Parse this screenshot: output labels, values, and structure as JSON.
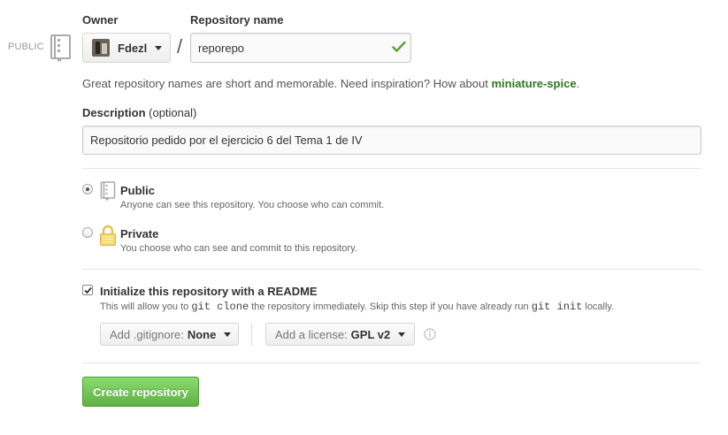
{
  "visibility_tag": "PUBLIC",
  "owner": {
    "label": "Owner",
    "selected": "Fdezl"
  },
  "separator": "/",
  "repository": {
    "label": "Repository name",
    "value": "reporepo"
  },
  "hint": {
    "text": "Great repository names are short and memorable. Need inspiration? How about ",
    "suggestion": "miniature-spice",
    "suffix": "."
  },
  "description": {
    "label": "Description",
    "optional": "(optional)",
    "value": "Repositorio pedido por el ejercicio 6 del Tema 1 de IV"
  },
  "visibility": {
    "public": {
      "title": "Public",
      "note": "Anyone can see this repository. You choose who can commit.",
      "checked": true
    },
    "private": {
      "title": "Private",
      "note": "You choose who can see and commit to this repository.",
      "checked": false
    }
  },
  "readme": {
    "checked": true,
    "title": "Initialize this repository with a README",
    "note_before": "This will allow you to ",
    "code1": "git clone",
    "note_middle": " the repository immediately. Skip this step if you have already run ",
    "code2": "git init",
    "note_after": " locally."
  },
  "gitignore": {
    "label": "Add .gitignore:",
    "value": "None"
  },
  "license": {
    "label": "Add a license:",
    "value": "GPL v2"
  },
  "create_button": "Create repository",
  "colors": {
    "accent_green": "#60b044",
    "suggestion_green": "#2d7a1f",
    "check_green": "#55a532",
    "lock_yellow": "#e9c046"
  },
  "icons": [
    "repo-icon",
    "chevron-down-icon",
    "check-icon",
    "lock-icon",
    "info-icon"
  ]
}
